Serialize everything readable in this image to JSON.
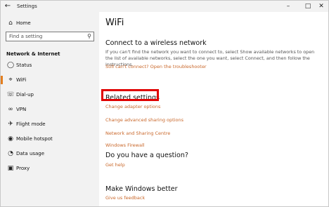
{
  "window": {
    "title": "Settings"
  },
  "sidebar": {
    "home": "Home",
    "search_placeholder": "Find a setting",
    "section": "Network & Internet",
    "items": [
      {
        "label": "Status"
      },
      {
        "label": "WiFi"
      },
      {
        "label": "Dial-up"
      },
      {
        "label": "VPN"
      },
      {
        "label": "Flight mode"
      },
      {
        "label": "Mobile hotspot"
      },
      {
        "label": "Data usage"
      },
      {
        "label": "Proxy"
      }
    ]
  },
  "main": {
    "title": "WiFi",
    "connect_heading": "Connect to a wireless network",
    "connect_text": "If you can't find the network you want to connect to, select Show available networks to open the list of available networks, select the one you want, select Connect, and then follow the instructions.",
    "troubleshooter_link": "Still can't connect? Open the troubleshooter",
    "related_heading": "Related settings",
    "related_links": [
      "Change adapter options",
      "Change advanced sharing options",
      "Network and Sharing Centre",
      "Windows Firewall"
    ],
    "question_heading": "Do you have a question?",
    "help_link": "Get help",
    "better_heading": "Make Windows better",
    "feedback_link": "Give us feedback"
  },
  "colors": {
    "accent": "#e37e1e",
    "link": "#c9672a",
    "highlight": "#e00000"
  }
}
